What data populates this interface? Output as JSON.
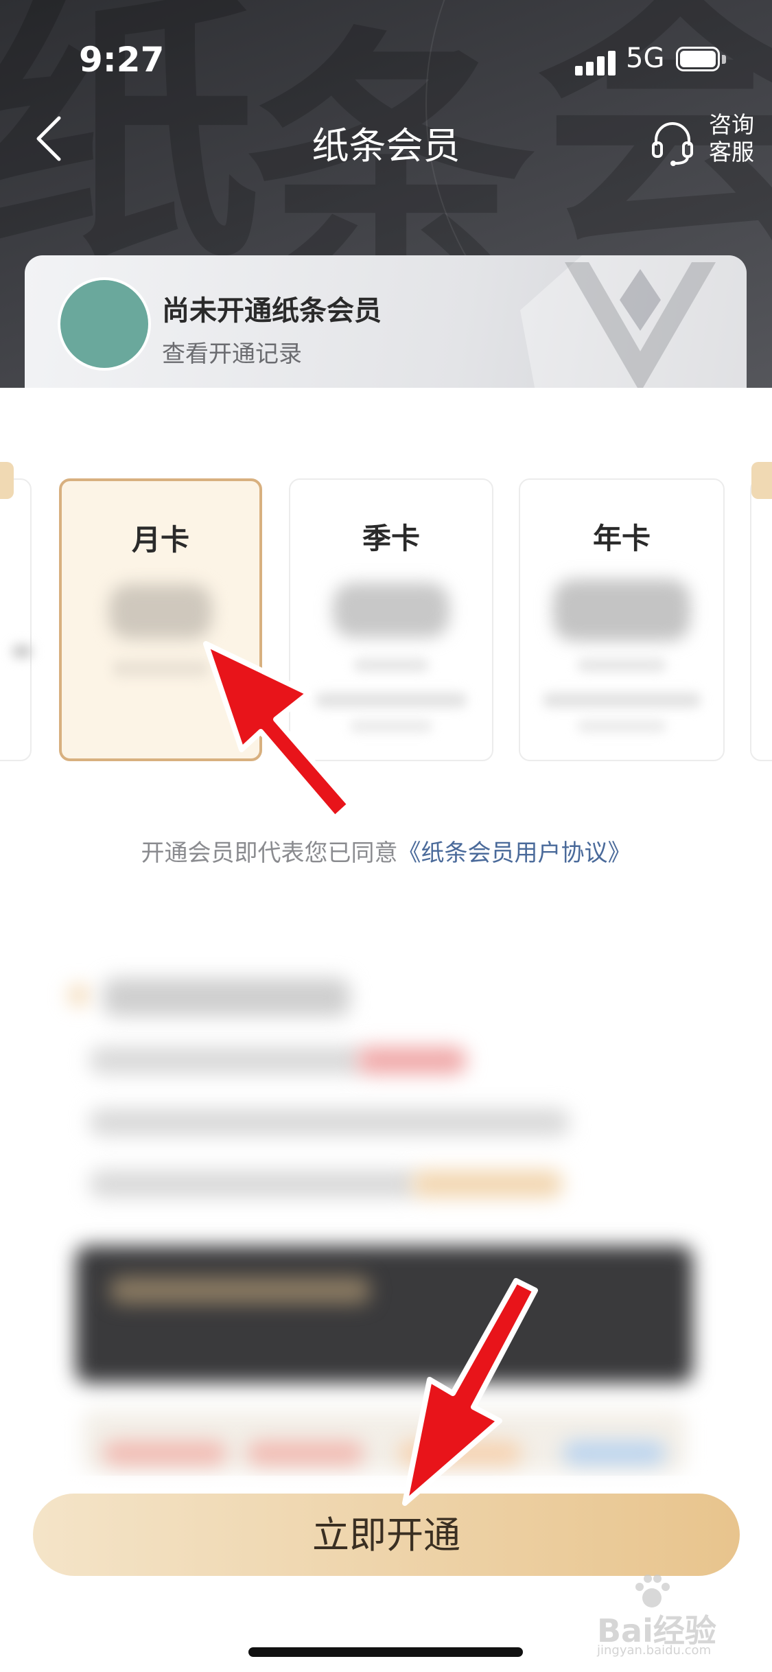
{
  "status_bar": {
    "time": "9:27",
    "network": "5G"
  },
  "nav": {
    "title": "纸条会员",
    "support_label_line1": "咨询",
    "support_label_line2": "客服"
  },
  "member_card": {
    "title": "尚未开通纸条会员",
    "link": "查看开通记录"
  },
  "plans": [
    {
      "name": "月卡",
      "selected": true
    },
    {
      "name": "季卡",
      "selected": false
    },
    {
      "name": "年卡",
      "selected": false
    }
  ],
  "agreement": {
    "prefix": "开通会员即代表您已同意",
    "link": "《纸条会员用户协议》"
  },
  "cta": {
    "label": "立即开通"
  },
  "watermark": {
    "text": "Bai经验",
    "sub": "jingyan.baidu.com"
  },
  "colors": {
    "accent": "#e8c48d",
    "selected_border": "#d8b07f",
    "selected_bg": "#fcf4e6",
    "annotation_arrow": "#e8141a"
  }
}
